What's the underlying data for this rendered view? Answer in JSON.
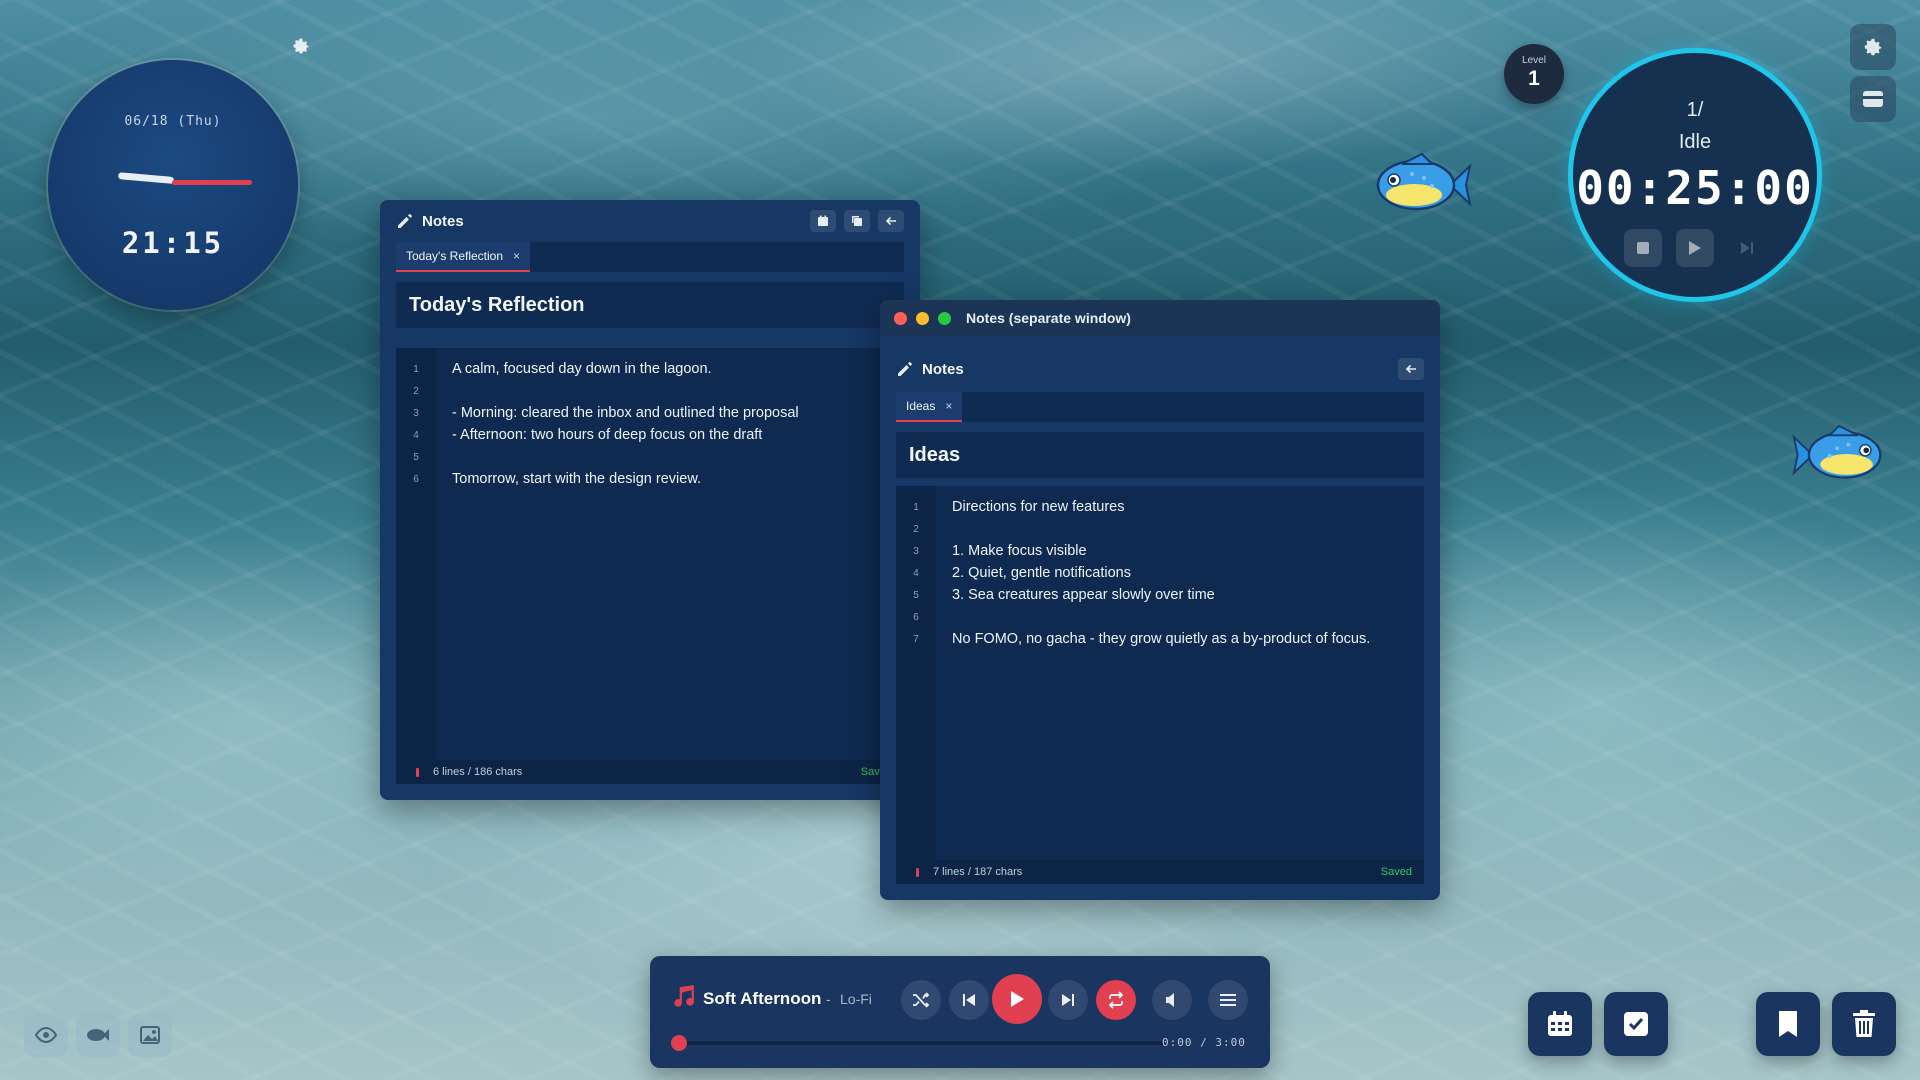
{
  "clock": {
    "date": "06/18 (Thu)",
    "time": "21:15"
  },
  "level": {
    "label": "Level",
    "value": "1"
  },
  "timer": {
    "count": "1/",
    "state": "Idle",
    "time": "00:25:00"
  },
  "notes_main": {
    "title": "Notes",
    "tab": "Today's Reflection",
    "tab_close": "×",
    "doc_title": "Today's Reflection",
    "lines": [
      {
        "n": "1",
        "text": "A calm, focused day down in the lagoon."
      },
      {
        "n": "2",
        "text": ""
      },
      {
        "n": "3",
        "text": "- Morning: cleared the inbox and outlined the proposal"
      },
      {
        "n": "4",
        "text": "- Afternoon: two hours of deep focus on the draft"
      },
      {
        "n": "5",
        "text": ""
      },
      {
        "n": "6",
        "text": "Tomorrow, start with the design review."
      }
    ],
    "status": "6 lines / 186 chars",
    "saved": "Saved"
  },
  "notes_window": {
    "window_title": "Notes (separate window)",
    "title": "Notes",
    "tab": "Ideas",
    "tab_close": "×",
    "doc_title": "Ideas",
    "lines": [
      {
        "n": "1",
        "text": "Directions for new features"
      },
      {
        "n": "2",
        "text": ""
      },
      {
        "n": "3",
        "text": "1. Make focus visible"
      },
      {
        "n": "4",
        "text": "2. Quiet, gentle notifications"
      },
      {
        "n": "5",
        "text": "3. Sea creatures appear slowly over time"
      },
      {
        "n": "6",
        "text": ""
      },
      {
        "n": "7",
        "text": "No FOMO, no gacha - they grow quietly as a by-product of focus."
      }
    ],
    "status": "7 lines / 187 chars",
    "saved": "Saved"
  },
  "player": {
    "song": "Soft Afternoon",
    "separator": "-",
    "genre": "Lo-Fi",
    "time": "0:00 / 3:00",
    "progress": 0
  },
  "colors": {
    "accent": "#e0404f",
    "timer_ring": "#1ec7ea",
    "panel": "#173764",
    "saved": "#37c95a"
  },
  "icons": [
    "gear-icon",
    "pencil-icon",
    "calendar-icon",
    "copy-icon",
    "arrow-left-icon",
    "stop-icon",
    "play-icon",
    "skip-icon",
    "music-note-icon",
    "shuffle-icon",
    "previous-icon",
    "next-icon",
    "repeat-icon",
    "volume-icon",
    "menu-icon",
    "eye-icon",
    "fish-icon",
    "image-icon",
    "checkbox-icon",
    "bookmark-icon",
    "trash-icon",
    "card-icon"
  ]
}
